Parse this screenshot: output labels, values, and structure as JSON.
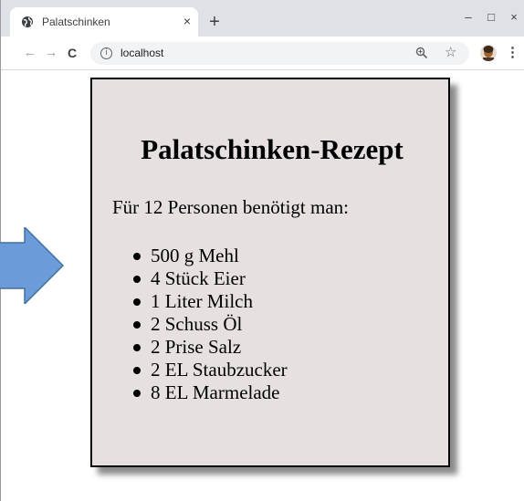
{
  "browser": {
    "tab": {
      "title": "Palatschinken",
      "favicon": "globe-icon",
      "close_label": "×"
    },
    "new_tab_label": "+",
    "window_controls": {
      "minimize": "–",
      "maximize": "□",
      "close": "×"
    },
    "toolbar": {
      "back_icon": "←",
      "forward_icon": "→",
      "reload_icon": "C",
      "info_icon": "i",
      "url": "localhost",
      "zoom_icon": "zoom-icon",
      "bookmark_icon": "☆",
      "menu_icon": "⋮"
    }
  },
  "page": {
    "arrow_color": "#6b9bd8",
    "card_background": "#e6e0e0",
    "recipe": {
      "title": "Palatschinken-Rezept",
      "intro": "Für 12 Personen benötigt man:",
      "ingredients": [
        "500 g Mehl",
        "4 Stück Eier",
        "1 Liter Milch",
        "2 Schuss Öl",
        "2 Prise Salz",
        "2 EL Staubzucker",
        "8 EL Marmelade"
      ]
    }
  }
}
